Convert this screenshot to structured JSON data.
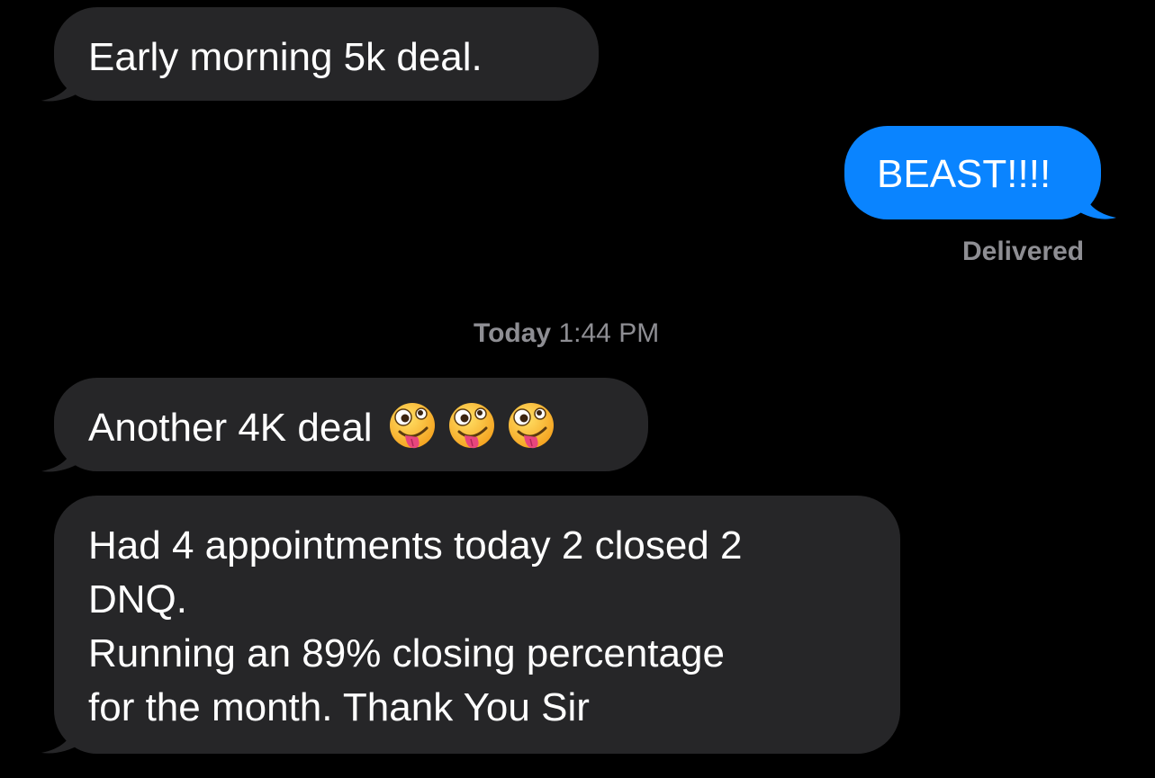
{
  "thread": {
    "messages": [
      {
        "direction": "incoming",
        "text": "Early morning 5k deal."
      },
      {
        "direction": "outgoing",
        "text": "BEAST!!!!"
      },
      {
        "direction": "incoming",
        "text": "Another 4K deal",
        "emoji": [
          "zany-face-icon",
          "zany-face-icon",
          "zany-face-icon"
        ]
      },
      {
        "direction": "incoming",
        "lines": [
          "Had 4 appointments today 2 closed 2",
          "DNQ.",
          "Running an 89% closing percentage",
          "for the month. Thank You Sir"
        ]
      }
    ],
    "delivered_label": "Delivered",
    "timestamp": {
      "day": "Today",
      "time": "1:44 PM"
    }
  },
  "colors": {
    "background": "#000000",
    "incoming_bubble": "#262628",
    "outgoing_bubble": "#0a84ff",
    "meta_text": "#8e8e93"
  }
}
